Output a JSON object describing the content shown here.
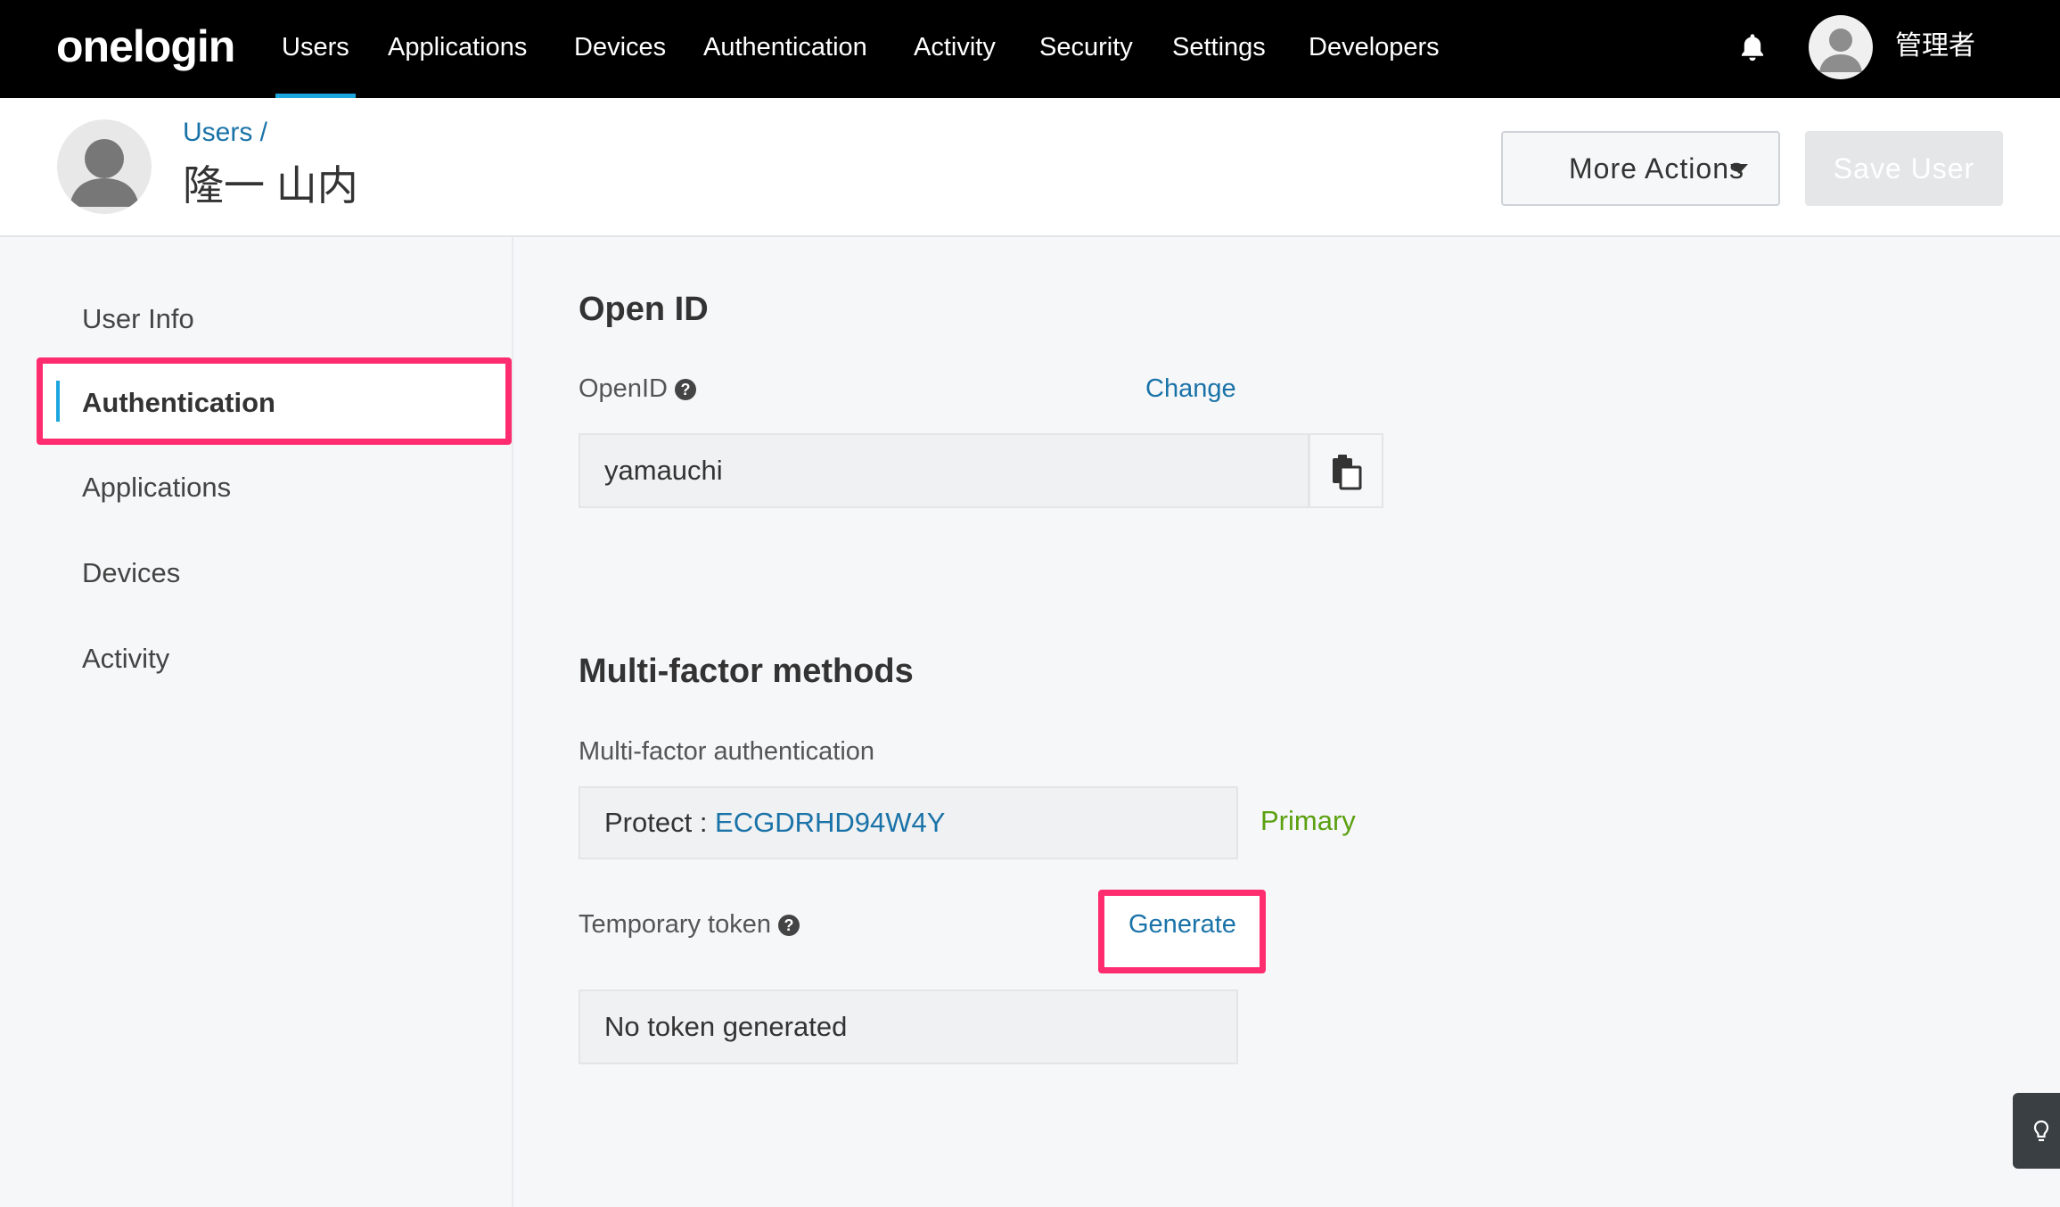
{
  "nav": {
    "logo": "onelogin",
    "items": [
      "Users",
      "Applications",
      "Devices",
      "Authentication",
      "Activity",
      "Security",
      "Settings",
      "Developers"
    ],
    "active": "Users",
    "user": "管理者"
  },
  "header": {
    "breadcrumb": "Users /",
    "user_name": "隆一 山内",
    "more_actions": "More Actions",
    "save_user": "Save User"
  },
  "sidebar": {
    "items": [
      "User Info",
      "Authentication",
      "Applications",
      "Devices",
      "Activity"
    ],
    "active": "Authentication"
  },
  "openid": {
    "title": "Open ID",
    "label": "OpenID",
    "change": "Change",
    "value": "yamauchi"
  },
  "mfa": {
    "title": "Multi-factor methods",
    "label": "Multi-factor authentication",
    "device_prefix": "Protect : ",
    "device_id": "ECGDRHD94W4Y",
    "primary": "Primary",
    "temp_label": "Temporary token",
    "generate": "Generate",
    "token_value": "No token generated"
  },
  "icons": {
    "bell": "bell-icon",
    "help": "question-circle-icon",
    "copy": "copy-icon",
    "caret": "caret-down-icon",
    "hint": "lightbulb-icon"
  },
  "colors": {
    "nav_bg": "#000000",
    "accent": "#1ca6df",
    "link": "#1a73a8",
    "highlight": "#ff2d6f",
    "primary_green": "#5ba010"
  }
}
